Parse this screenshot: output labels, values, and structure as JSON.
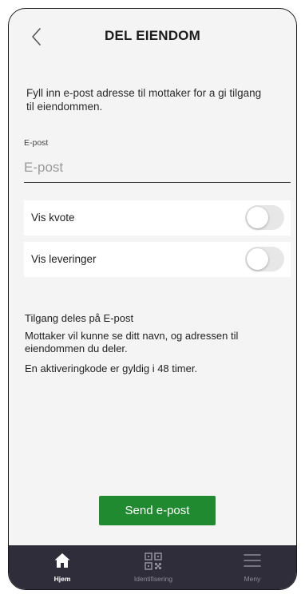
{
  "header": {
    "title": "DEL EIENDOM",
    "back_icon": "chevron-left-icon"
  },
  "intro": {
    "text": "Fyll inn e-post adresse til mottaker for a gi tilgang til eiendommen."
  },
  "email": {
    "label": "E-post",
    "value": "",
    "placeholder": "E-post"
  },
  "toggles": [
    {
      "label": "Vis kvote",
      "on": false
    },
    {
      "label": "Vis leveringer",
      "on": false
    }
  ],
  "info": {
    "line1": "Tilgang deles på E-post",
    "line2": "Mottaker vil kunne se ditt navn, og adressen til eiendommen du deler.",
    "line3": "En aktiveringkode er gyldig i 48 timer."
  },
  "send_button": {
    "label": "Send e-post",
    "color": "#1f8a2f"
  },
  "tabbar": {
    "background": "#2f2d3a",
    "tabs": [
      {
        "label": "Hjem",
        "icon": "home-icon",
        "active": true
      },
      {
        "label": "Identifisering",
        "icon": "qr-code-icon",
        "active": false
      },
      {
        "label": "Meny",
        "icon": "hamburger-menu-icon",
        "active": false
      }
    ]
  }
}
